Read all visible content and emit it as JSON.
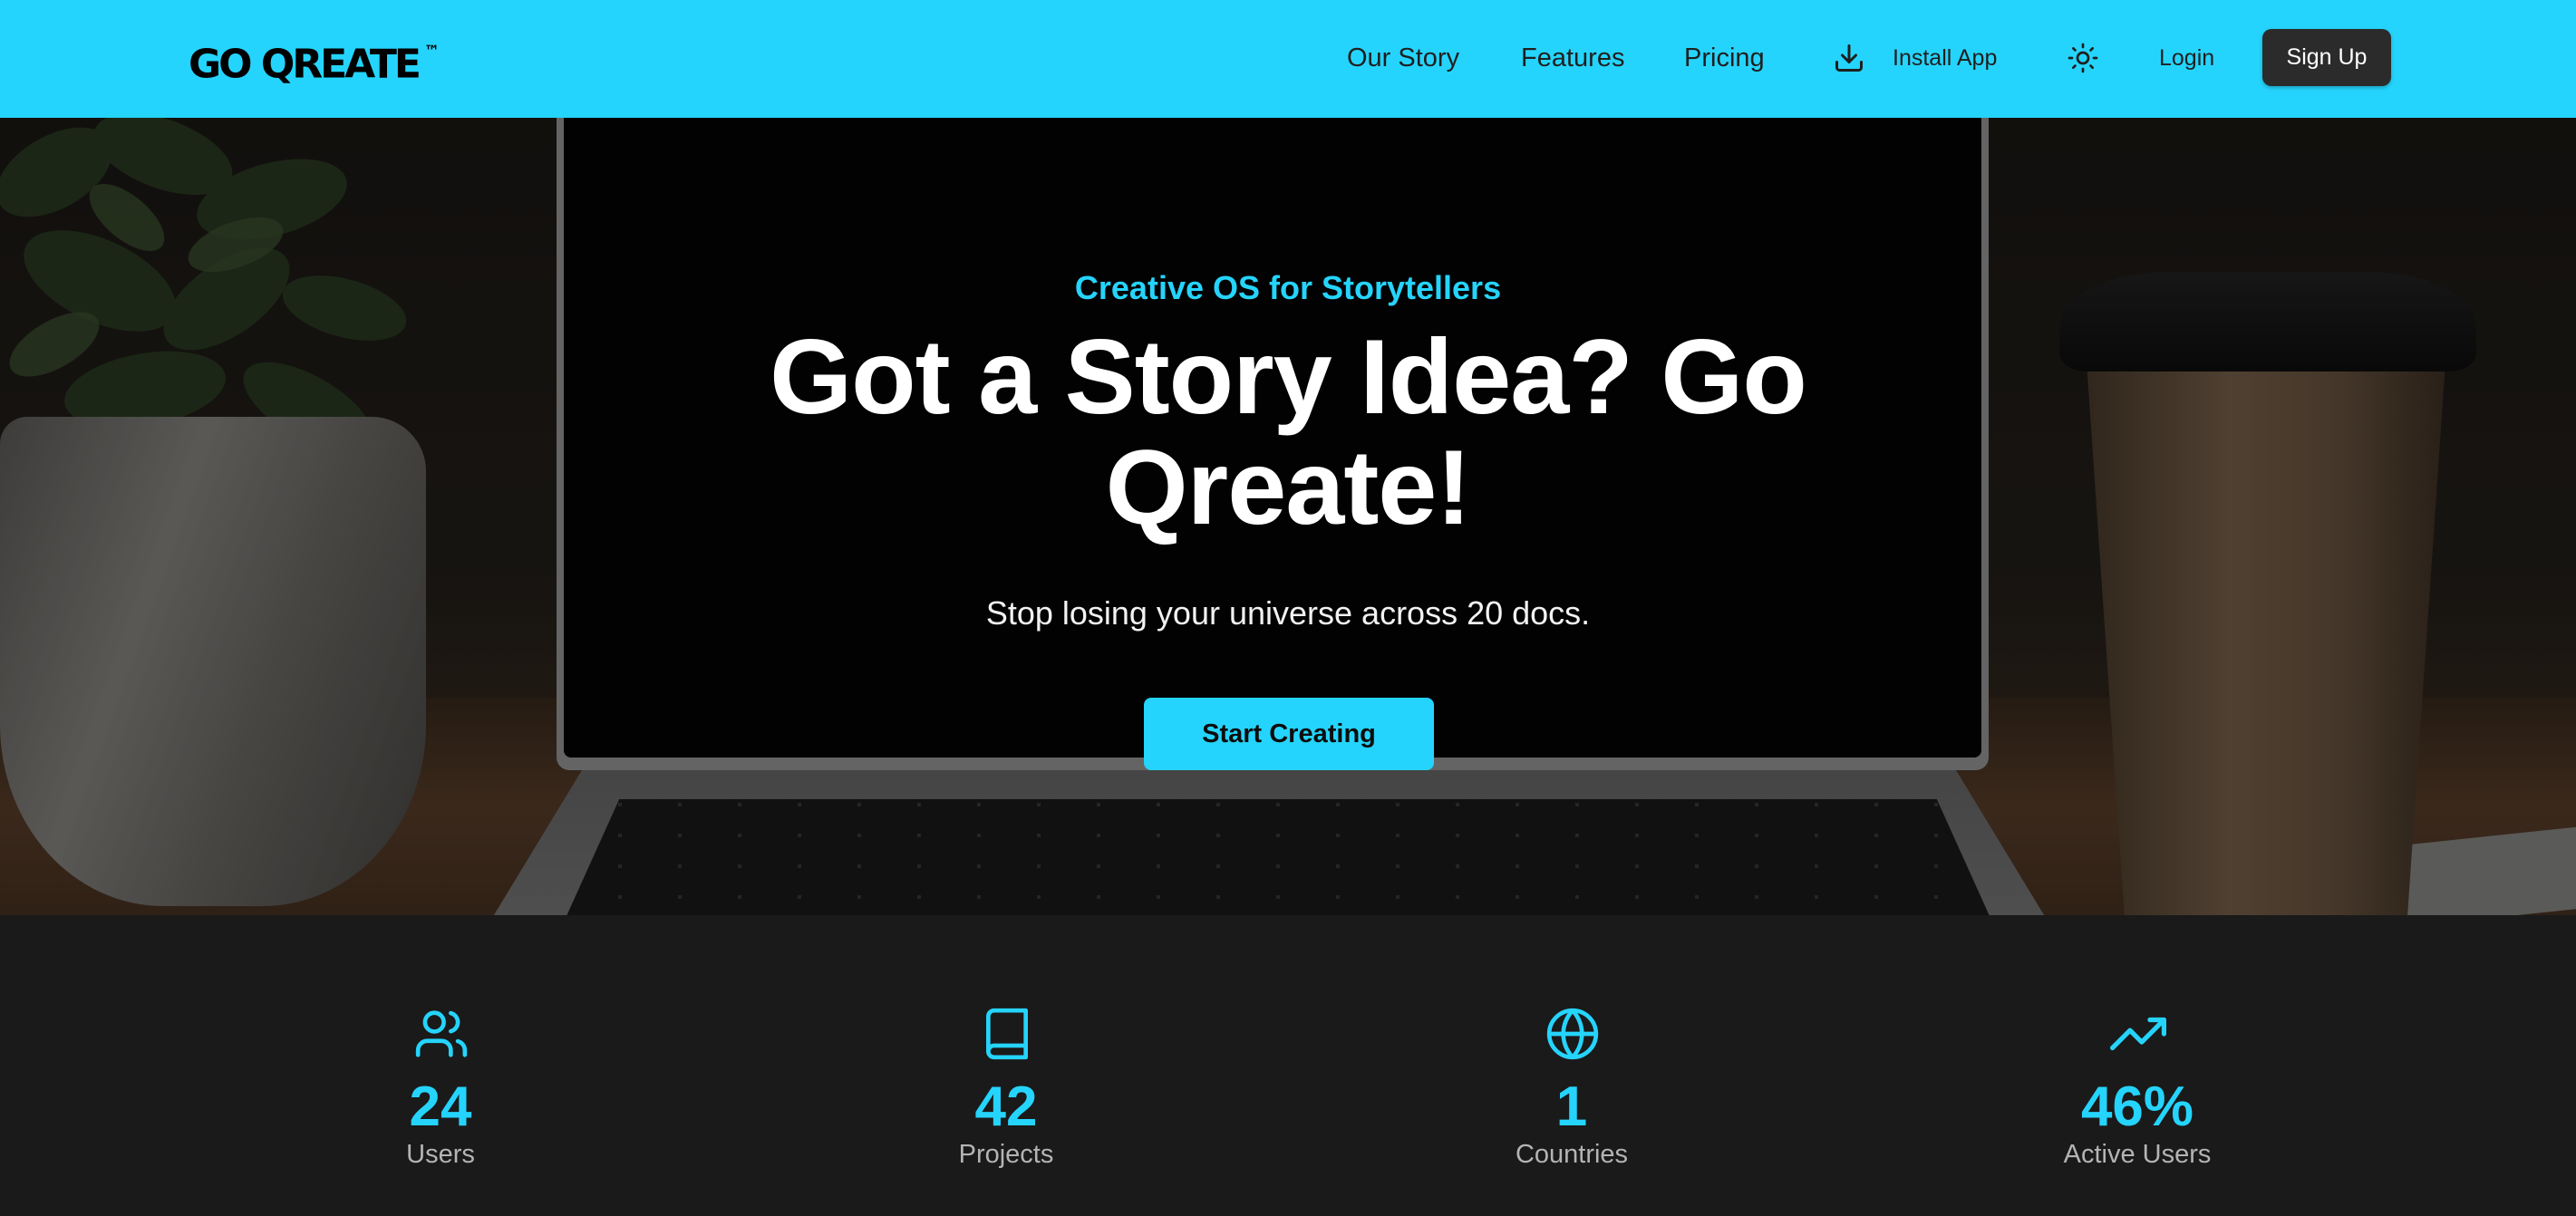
{
  "brand": {
    "name": "GO QREATE",
    "trademark": "™"
  },
  "nav": {
    "links": [
      "Our Story",
      "Features",
      "Pricing"
    ],
    "install_label": "Install App",
    "login_label": "Login",
    "signup_label": "Sign Up",
    "accent_color": "#25d4fc"
  },
  "hero": {
    "eyebrow": "Creative OS for Storytellers",
    "headline": "Got a Story Idea? Go Qreate!",
    "subline": "Stop losing your universe across 20 docs.",
    "cta_label": "Start Creating"
  },
  "stats": [
    {
      "icon": "users-icon",
      "value": "24",
      "label": "Users"
    },
    {
      "icon": "book-icon",
      "value": "42",
      "label": "Projects"
    },
    {
      "icon": "globe-icon",
      "value": "1",
      "label": "Countries"
    },
    {
      "icon": "trending-up-icon",
      "value": "46%",
      "label": "Active Users"
    }
  ]
}
